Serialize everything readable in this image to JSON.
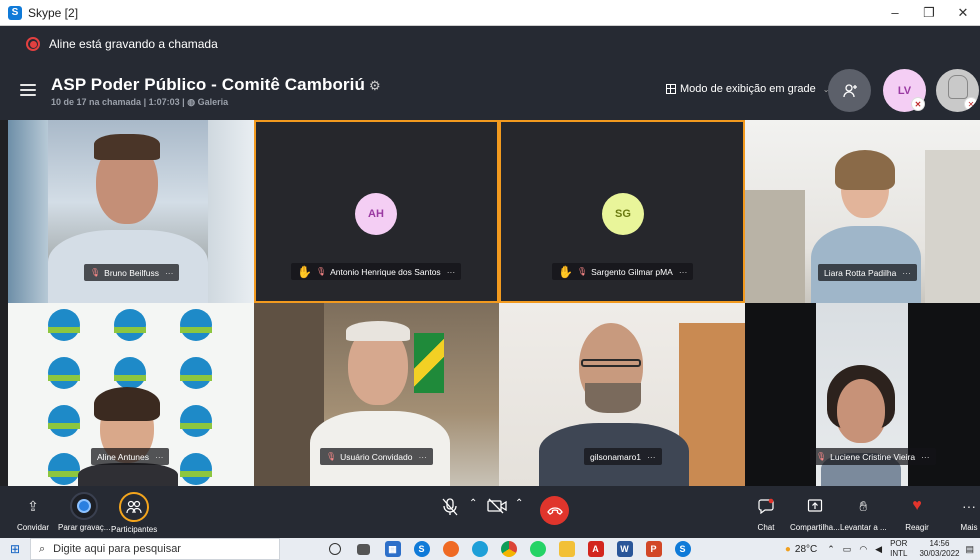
{
  "window": {
    "title": "Skype [2]",
    "controls": [
      "–",
      "❐",
      "✕"
    ]
  },
  "recording": {
    "text": "Aline está gravando a chamada"
  },
  "header": {
    "title": "ASP Poder Público - Comitê Camboriú",
    "title_icon": "gear-icon",
    "subtitle_count": "10 de 17 na chamada",
    "subtitle_time": "1:07:03",
    "subtitle_sep": "|",
    "subtitle_view": "Galeria",
    "view_mode_label": "Modo de exibição em grade",
    "avatar_lv": "LV"
  },
  "participants": [
    {
      "name": "Bruno Beilfuss",
      "muted": true,
      "hand": false
    },
    {
      "name": "Antonio Henrique dos Santos",
      "initials": "AH",
      "muted": true,
      "hand": true
    },
    {
      "name": "Sargento Gilmar pMA",
      "initials": "SG",
      "muted": true,
      "hand": true
    },
    {
      "name": "Liara Rotta Padilha",
      "muted": false,
      "hand": false
    },
    {
      "name": "Aline Antunes",
      "muted": false,
      "hand": false
    },
    {
      "name": "Usuário Convidado",
      "muted": true,
      "hand": false
    },
    {
      "name": "gilsonamaro1",
      "muted": false,
      "hand": false
    },
    {
      "name": "Luciene Cristine Vieira",
      "muted": true,
      "hand": false
    }
  ],
  "name_tag_menu": "···",
  "toolbar": {
    "invite": "Convidar",
    "stop_recording": "Parar gravaç...",
    "participants": "Participantes",
    "chat": "Chat",
    "share": "Compartilha...",
    "raise_hand": "Levantar a ...",
    "react": "Reagir",
    "more": "Mais"
  },
  "taskbar": {
    "search_placeholder": "Digite aqui para pesquisar",
    "weather": "28°C",
    "lang_1": "POR",
    "lang_2": "INTL",
    "time": "14:56",
    "date": "30/03/2022"
  },
  "colors": {
    "accent_orange": "#f29a1f",
    "hangup_red": "#e0352c",
    "bg_dark": "#262a33",
    "ah_avatar": "#f4cef4",
    "sg_avatar": "#e9f59a"
  }
}
